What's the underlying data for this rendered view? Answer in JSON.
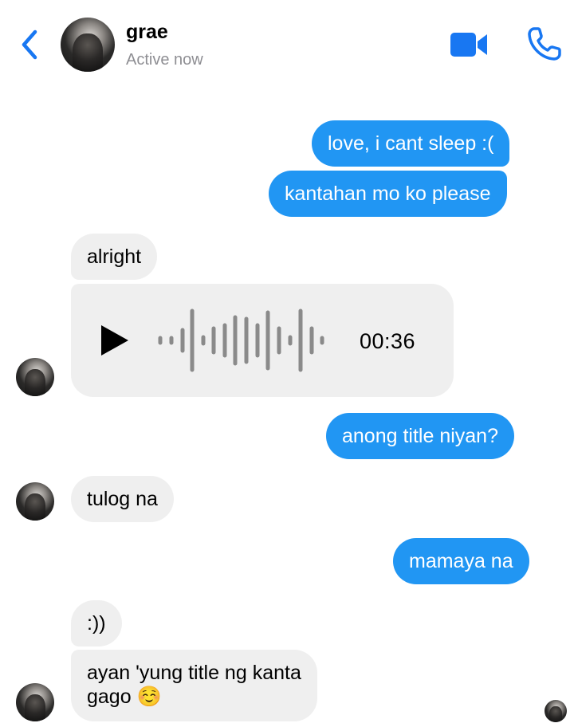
{
  "header": {
    "name": "grae",
    "status": "Active now",
    "back_icon": "chevron-left-icon",
    "video_icon": "video-camera-icon",
    "call_icon": "phone-icon",
    "accent_color": "#1877f2"
  },
  "messages": [
    {
      "sender": "me",
      "text": "love, i cant sleep :("
    },
    {
      "sender": "me",
      "text": "kantahan mo ko please"
    },
    {
      "sender": "grae",
      "text": "alright"
    },
    {
      "sender": "grae",
      "type": "voice",
      "duration": "00:36"
    },
    {
      "sender": "me",
      "text": "anong title niyan?"
    },
    {
      "sender": "grae",
      "text": "tulog na"
    },
    {
      "sender": "me",
      "text": "mamaya na"
    },
    {
      "sender": "grae",
      "text": ":))"
    },
    {
      "sender": "grae",
      "text_line1": "ayan 'yung title ng kanta",
      "text_line2": "gago ☺️"
    }
  ],
  "colors": {
    "outgoing_bubble": "#2196f3",
    "incoming_bubble": "#efefef"
  }
}
